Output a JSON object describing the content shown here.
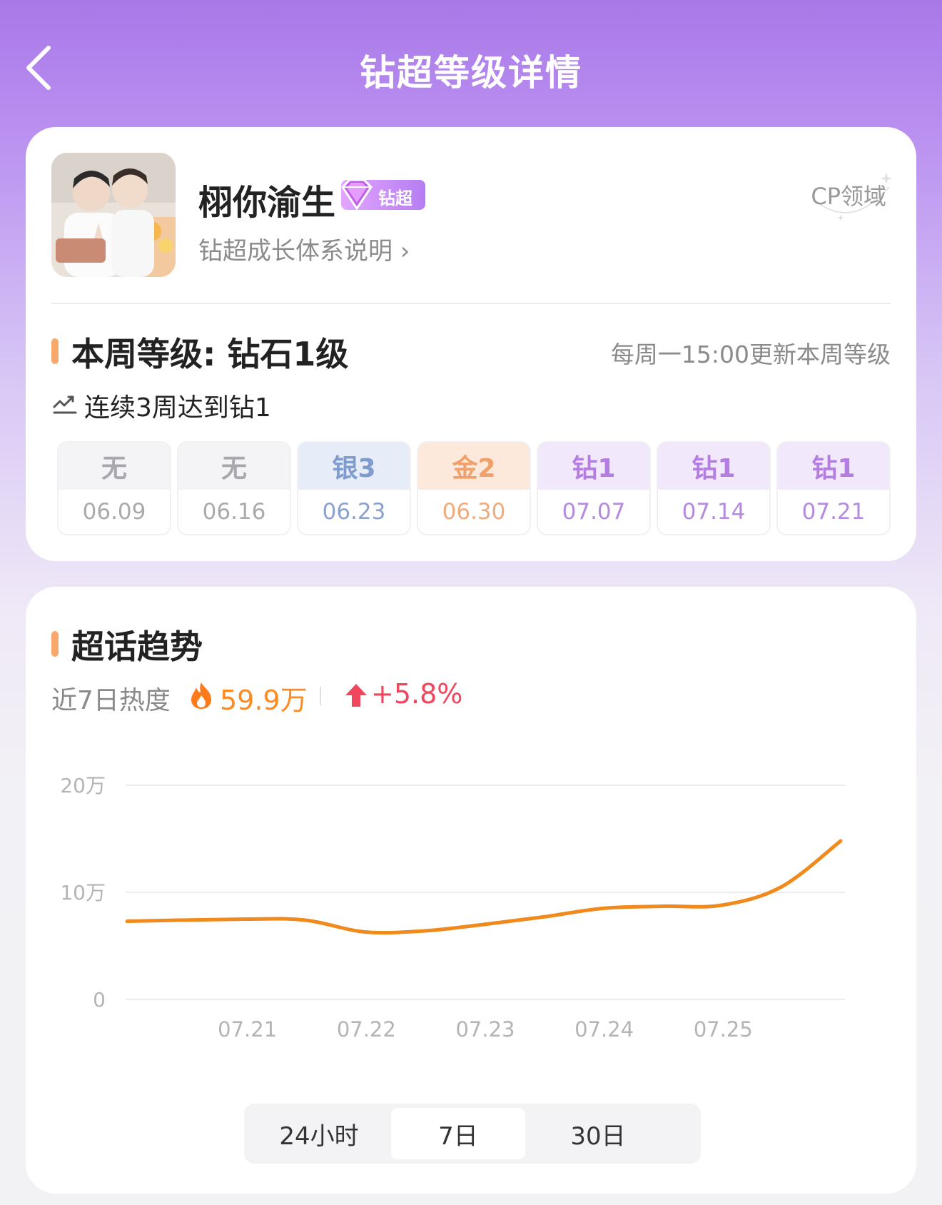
{
  "header": {
    "title": "钻超等级详情"
  },
  "topic": {
    "name": "栩你渝生",
    "badge": "钻超",
    "explain_link": "钻超成长体系说明 ›",
    "domain": "CP领域"
  },
  "level": {
    "this_week": "本周等级: 钻石1级",
    "update_note": "每周一15:00更新本周等级",
    "streak": "连续3周达到钻1",
    "weeks": [
      {
        "level": "无",
        "date": "06.09",
        "tier": "none"
      },
      {
        "level": "无",
        "date": "06.16",
        "tier": "none"
      },
      {
        "level": "银3",
        "date": "06.23",
        "tier": "silver"
      },
      {
        "level": "金2",
        "date": "06.30",
        "tier": "gold"
      },
      {
        "level": "钻1",
        "date": "07.07",
        "tier": "diamond"
      },
      {
        "level": "钻1",
        "date": "07.14",
        "tier": "diamond"
      },
      {
        "level": "钻1",
        "date": "07.21",
        "tier": "diamond"
      }
    ]
  },
  "tier_colors": {
    "none": {
      "top": "#f4f4f6",
      "text": "#a9a9ad",
      "date": "#aaaaaa"
    },
    "silver": {
      "top": "#e6edf8",
      "text": "#7f9ccc",
      "date": "#8aa2cc"
    },
    "gold": {
      "top": "#fde9dc",
      "text": "#f0a06a",
      "date": "#f0ab7d"
    },
    "diamond": {
      "top": "#f1e8fb",
      "text": "#b47ee0",
      "date": "#b58be0"
    }
  },
  "trend": {
    "title": "超话趋势",
    "heat_label": "近7日热度",
    "heat_value": "59.9万",
    "growth": "+5.8%",
    "range_tabs": [
      {
        "label": "24小时",
        "active": false
      },
      {
        "label": "7日",
        "active": true
      },
      {
        "label": "30日",
        "active": false
      }
    ]
  },
  "chart_data": {
    "type": "line",
    "y_ticks": [
      {
        "value": 0,
        "label": "0"
      },
      {
        "value": 100000,
        "label": "10万"
      },
      {
        "value": 200000,
        "label": "20万"
      }
    ],
    "ylim": [
      0,
      200000
    ],
    "x_tick_labels": [
      "07.21",
      "07.22",
      "07.23",
      "07.24",
      "07.25"
    ],
    "series": [
      {
        "color": "#f08a1c",
        "points": [
          {
            "x": "07.20",
            "y": 73000
          },
          {
            "x": "07.21",
            "y": 75000
          },
          {
            "x": "07.21 12:00",
            "y": 74000
          },
          {
            "x": "07.22",
            "y": 63000
          },
          {
            "x": "07.22 12:00",
            "y": 64000
          },
          {
            "x": "07.23",
            "y": 70000
          },
          {
            "x": "07.23 12:00",
            "y": 77000
          },
          {
            "x": "07.24",
            "y": 85000
          },
          {
            "x": "07.24 12:00",
            "y": 87000
          },
          {
            "x": "07.25",
            "y": 88000
          },
          {
            "x": "07.25 12:00",
            "y": 105000
          },
          {
            "x": "07.26",
            "y": 148000
          }
        ]
      }
    ],
    "grid": true
  }
}
